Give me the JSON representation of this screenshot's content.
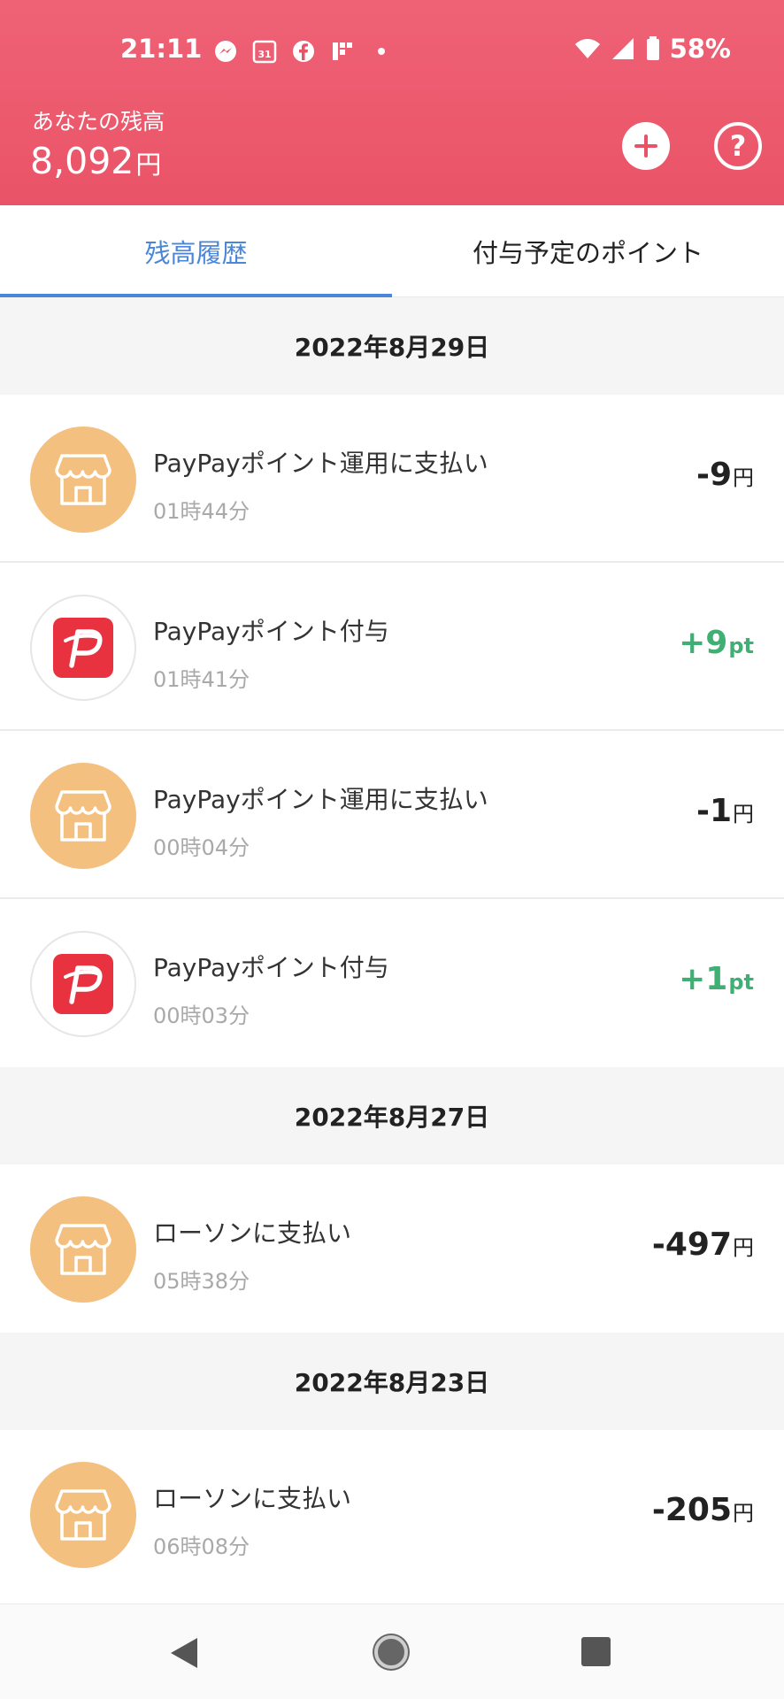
{
  "status_bar": {
    "time": "21:11",
    "calendar_day": "31",
    "battery": "58%",
    "icons": [
      "messenger-icon",
      "calendar-icon",
      "facebook-icon",
      "app-icon",
      "dot-icon",
      "wifi-icon",
      "signal-icon",
      "battery-icon"
    ]
  },
  "header": {
    "balance_label": "あなたの残高",
    "balance_amount": "8,092",
    "balance_unit": "円",
    "help_label": "?",
    "bg_color": "#ea5367"
  },
  "tabs": [
    {
      "label": "残高履歴",
      "active": true
    },
    {
      "label": "付与予定のポイント",
      "active": false
    }
  ],
  "groups": [
    {
      "date": "2022年8月29日",
      "items": [
        {
          "icon": "store-icon",
          "title": "PayPayポイント運用に支払い",
          "time": "01時44分",
          "amount": "-9",
          "unit": "円",
          "sign": "neg"
        },
        {
          "icon": "paypay-logo-icon",
          "title": "PayPayポイント付与",
          "time": "01時41分",
          "amount": "+9",
          "unit": "pt",
          "sign": "pos"
        },
        {
          "icon": "store-icon",
          "title": "PayPayポイント運用に支払い",
          "time": "00時04分",
          "amount": "-1",
          "unit": "円",
          "sign": "neg"
        },
        {
          "icon": "paypay-logo-icon",
          "title": "PayPayポイント付与",
          "time": "00時03分",
          "amount": "+1",
          "unit": "pt",
          "sign": "pos"
        }
      ]
    },
    {
      "date": "2022年8月27日",
      "items": [
        {
          "icon": "store-icon",
          "title": "ローソンに支払い",
          "time": "05時38分",
          "amount": "-497",
          "unit": "円",
          "sign": "neg"
        }
      ]
    },
    {
      "date": "2022年8月23日",
      "items": [
        {
          "icon": "store-icon",
          "title": "ローソンに支払い",
          "time": "06時08分",
          "amount": "-205",
          "unit": "円",
          "sign": "neg"
        }
      ]
    }
  ],
  "colors": {
    "accent_tab": "#4a86d9",
    "positive": "#3faf74",
    "store_avatar": "#f3c080",
    "paypay_red": "#e8323f"
  }
}
